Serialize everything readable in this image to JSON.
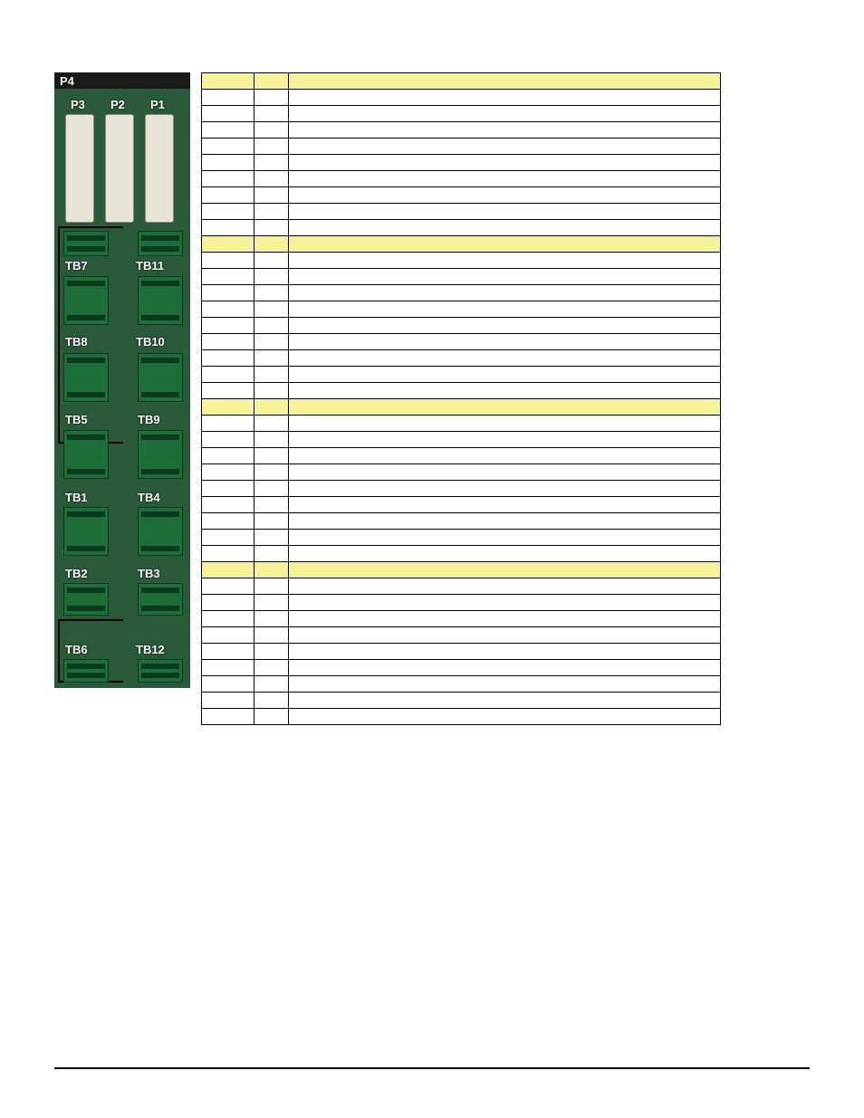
{
  "board_labels": {
    "p4": "P4",
    "p3": "P3",
    "p2": "P2",
    "p1": "P1",
    "tb7": "TB7",
    "tb11": "TB11",
    "tb8": "TB8",
    "tb10": "TB10",
    "tb5": "TB5",
    "tb9": "TB9",
    "tb1": "TB1",
    "tb4": "TB4",
    "tb2": "TB2",
    "tb3": "TB3",
    "tb6": "TB6",
    "tb12": "TB12"
  },
  "table": {
    "sections": [
      {
        "header": {
          "tb": "",
          "pin": "",
          "desc": ""
        },
        "rows": [
          {
            "tb": "",
            "pin": "",
            "desc": ""
          },
          {
            "tb": "",
            "pin": "",
            "desc": ""
          },
          {
            "tb": "",
            "pin": "",
            "desc": ""
          },
          {
            "tb": "",
            "pin": "",
            "desc": ""
          },
          {
            "tb": "",
            "pin": "",
            "desc": ""
          },
          {
            "tb": "",
            "pin": "",
            "desc": ""
          },
          {
            "tb": "",
            "pin": "",
            "desc": ""
          },
          {
            "tb": "",
            "pin": "",
            "desc": ""
          },
          {
            "tb": "",
            "pin": "",
            "desc": ""
          }
        ]
      },
      {
        "header": {
          "tb": "",
          "pin": "",
          "desc": ""
        },
        "rows": [
          {
            "tb": "",
            "pin": "",
            "desc": ""
          },
          {
            "tb": "",
            "pin": "",
            "desc": ""
          },
          {
            "tb": "",
            "pin": "",
            "desc": ""
          },
          {
            "tb": "",
            "pin": "",
            "desc": ""
          },
          {
            "tb": "",
            "pin": "",
            "desc": ""
          },
          {
            "tb": "",
            "pin": "",
            "desc": ""
          },
          {
            "tb": "",
            "pin": "",
            "desc": ""
          },
          {
            "tb": "",
            "pin": "",
            "desc": ""
          },
          {
            "tb": "",
            "pin": "",
            "desc": ""
          }
        ]
      },
      {
        "header": {
          "tb": "",
          "pin": "",
          "desc": ""
        },
        "rows": [
          {
            "tb": "",
            "pin": "",
            "desc": ""
          },
          {
            "tb": "",
            "pin": "",
            "desc": ""
          },
          {
            "tb": "",
            "pin": "",
            "desc": ""
          },
          {
            "tb": "",
            "pin": "",
            "desc": ""
          },
          {
            "tb": "",
            "pin": "",
            "desc": ""
          },
          {
            "tb": "",
            "pin": "",
            "desc": ""
          },
          {
            "tb": "",
            "pin": "",
            "desc": ""
          },
          {
            "tb": "",
            "pin": "",
            "desc": ""
          },
          {
            "tb": "",
            "pin": "",
            "desc": ""
          }
        ]
      },
      {
        "header": {
          "tb": "",
          "pin": "",
          "desc": ""
        },
        "rows": [
          {
            "tb": "",
            "pin": "",
            "desc": ""
          },
          {
            "tb": "",
            "pin": "",
            "desc": ""
          },
          {
            "tb": "",
            "pin": "",
            "desc": ""
          },
          {
            "tb": "",
            "pin": "",
            "desc": ""
          },
          {
            "tb": "",
            "pin": "",
            "desc": ""
          },
          {
            "tb": "",
            "pin": "",
            "desc": ""
          },
          {
            "tb": "",
            "pin": "",
            "desc": ""
          },
          {
            "tb": "",
            "pin": "",
            "desc": ""
          },
          {
            "tb": "",
            "pin": "",
            "desc": ""
          }
        ]
      }
    ]
  }
}
